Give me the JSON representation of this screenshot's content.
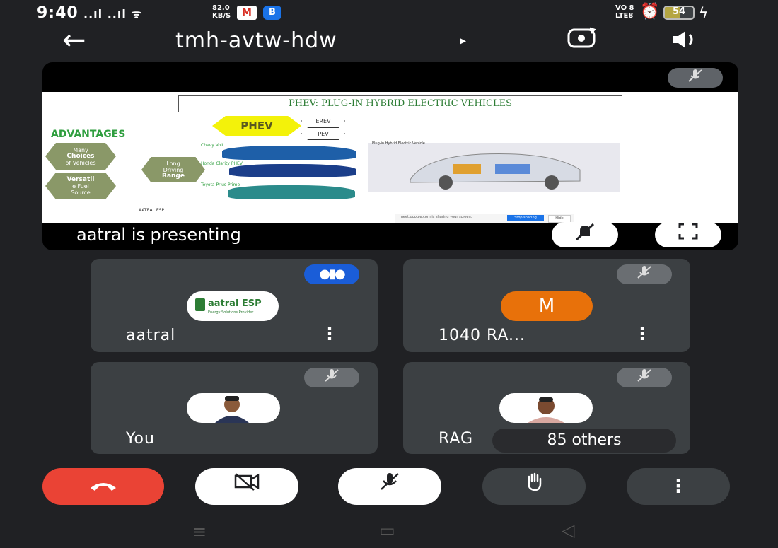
{
  "status_bar": {
    "time": "9:40",
    "signal": "..ıl ..ıl ᯤ",
    "speed_value": "82.0",
    "speed_unit": "KB/S",
    "gmail_icon": "M",
    "b_icon": "B",
    "volte_top": "VO 8",
    "volte_bottom": "LTE8",
    "battery_percent": 54,
    "battery_label": "54"
  },
  "header": {
    "meeting_code": "tmh-avtw-hdw",
    "play_icon": "▸",
    "back_icon": "←",
    "camflip_icon": "⟲",
    "speaker_icon": "🔈"
  },
  "presentation": {
    "slide": {
      "title": "PHEV: PLUG-IN HYBRID ELECTRIC VEHICLES",
      "advantages_heading": "ADVANTAGES",
      "hexagons": [
        {
          "line1": "Many",
          "line2": "Choices",
          "line3": "of Vehicles"
        },
        {
          "line1": "Long",
          "line2": "Driving",
          "line3": "Range"
        },
        {
          "line1": "Versatil",
          "line2": "e Fuel",
          "line3": "Source"
        }
      ],
      "phev_label": "PHEV",
      "erev_label": "EREV",
      "pev_label": "PEV",
      "car_labels": [
        "Chevy Volt",
        "Honda Clarity PHEV",
        "Toyota Prius Prime"
      ],
      "diagram_label": "Plug-in Hybrid Electric Vehicle",
      "footer": "AATRAL ESP",
      "share_bar": {
        "text": "meet.google.com is sharing your screen.",
        "stop_label": "Stop sharing",
        "hide_label": "Hide"
      }
    },
    "presenting_text": "aatral is presenting",
    "colors": {
      "slide_title": "#2d7d35",
      "phev": "#f3f20a"
    }
  },
  "participants": [
    {
      "name": "aatral",
      "avatar_text": "aatral ESP",
      "avatar_sub": "Energy Solutions Provider",
      "status": "speaking"
    },
    {
      "name": "1040 RA...",
      "avatar_letter": "M",
      "avatar_color": "#e8710a",
      "status": "muted"
    },
    {
      "name": "You",
      "status": "muted"
    },
    {
      "name": "RAG",
      "status": "muted"
    }
  ],
  "others_label": "85 others",
  "controls": {
    "end_call_color": "#ea4335",
    "end_call_icon": "phone-hangup-icon",
    "camera_icon": "camera-off-icon",
    "mic_icon": "mic-off-icon",
    "raise_hand_icon": "raise-hand-icon",
    "more_icon": "more-vertical-icon"
  },
  "nav_bar": {
    "recents_icon": "≡",
    "home_icon": "▭",
    "back_icon": "◁"
  }
}
